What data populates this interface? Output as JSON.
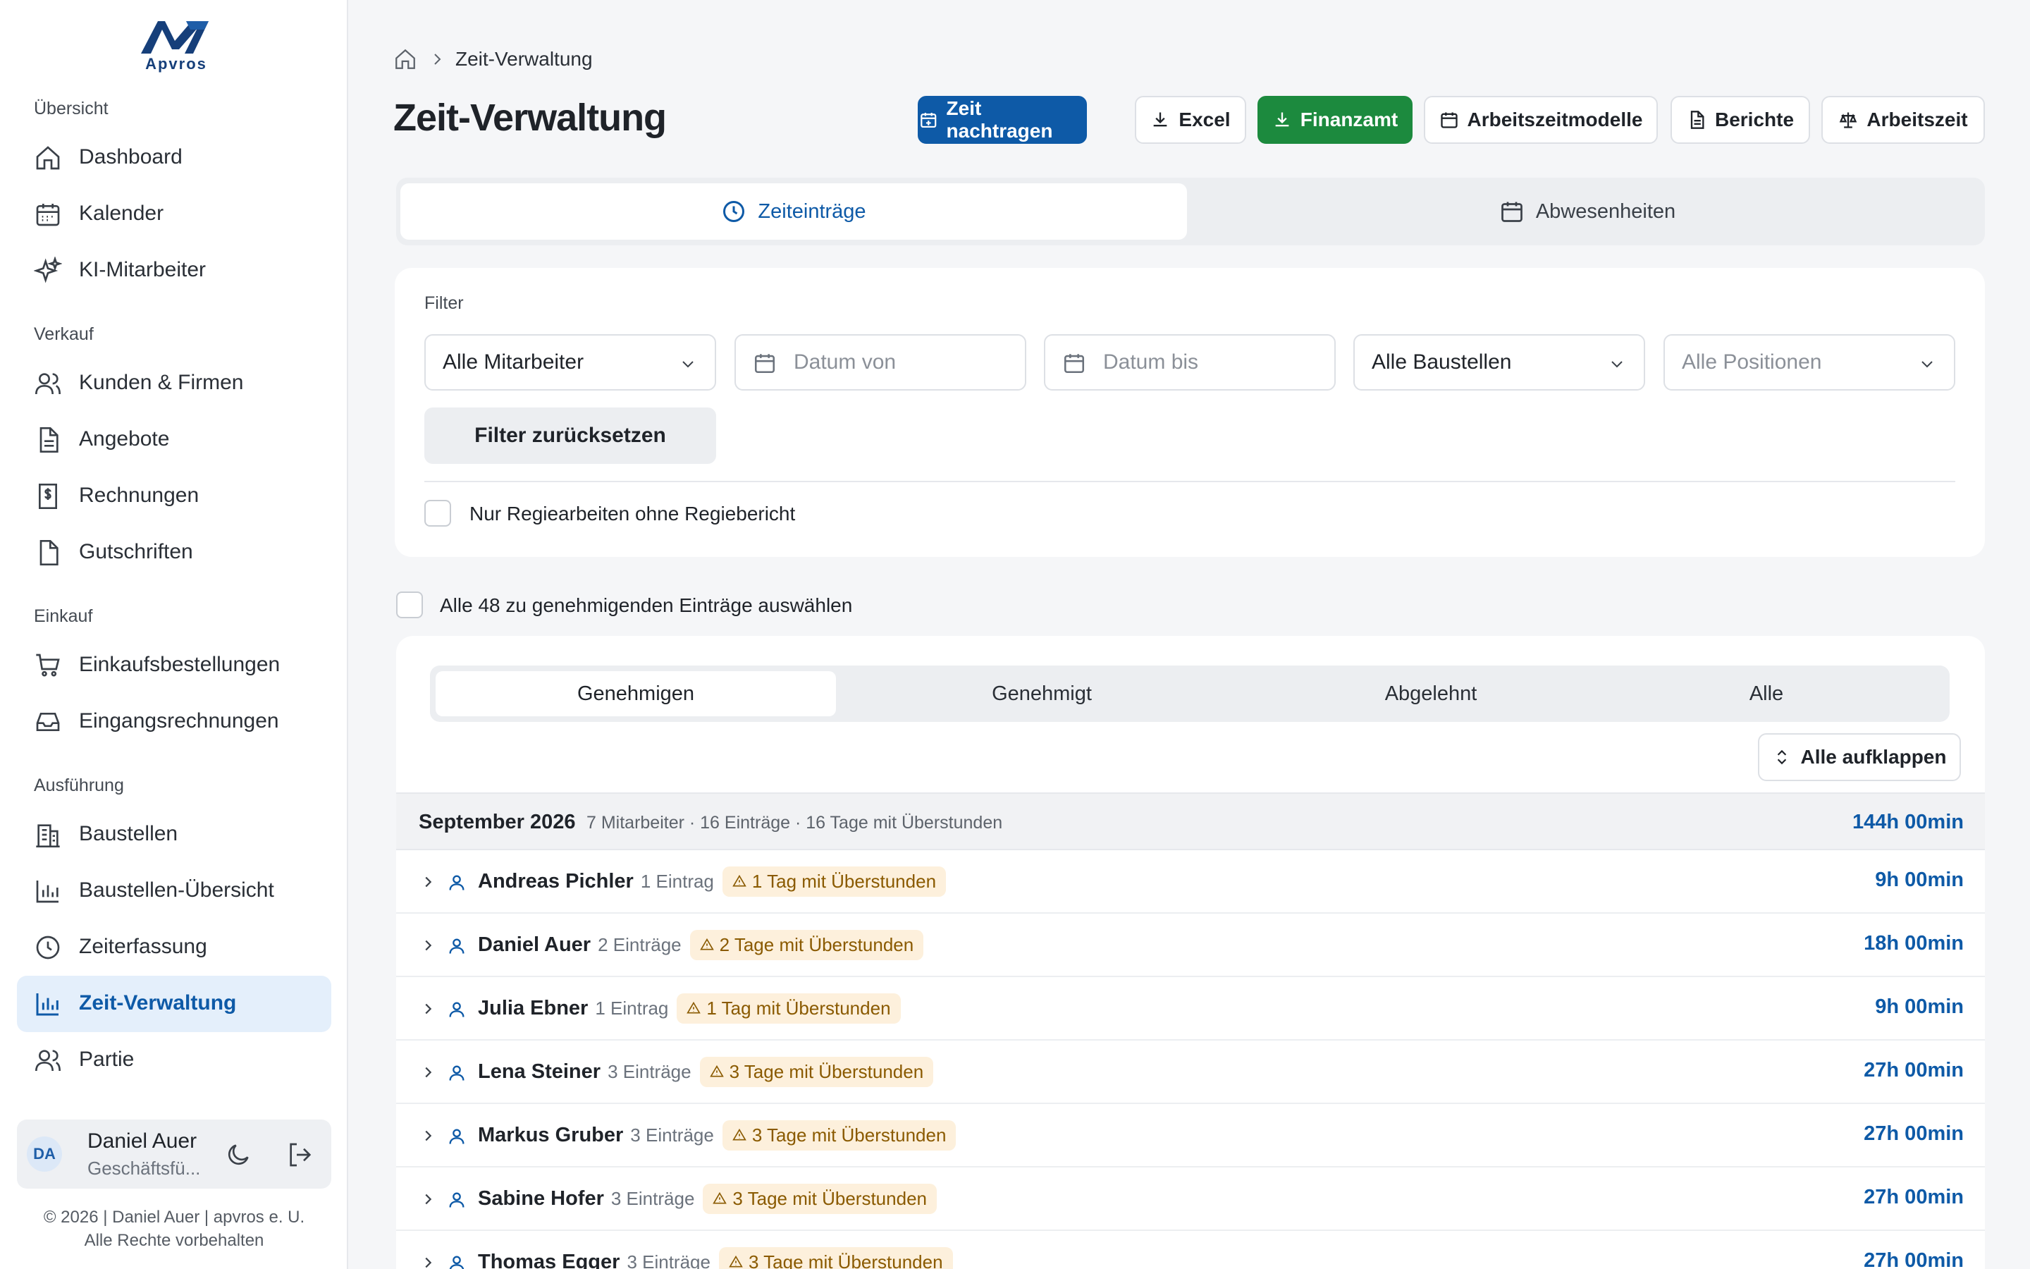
{
  "brand": {
    "logo_text": "Apvros"
  },
  "sidebar": {
    "sections": [
      {
        "title": "Übersicht",
        "items": [
          {
            "label": "Dashboard",
            "icon": "home-icon"
          },
          {
            "label": "Kalender",
            "icon": "calendar-icon"
          },
          {
            "label": "KI-Mitarbeiter",
            "icon": "sparkles-icon"
          }
        ]
      },
      {
        "title": "Verkauf",
        "items": [
          {
            "label": "Kunden & Firmen",
            "icon": "users-icon"
          },
          {
            "label": "Angebote",
            "icon": "document-icon"
          },
          {
            "label": "Rechnungen",
            "icon": "invoice-icon"
          },
          {
            "label": "Gutschriften",
            "icon": "credit-note-icon"
          }
        ]
      },
      {
        "title": "Einkauf",
        "items": [
          {
            "label": "Einkaufsbestellungen",
            "icon": "cart-icon"
          },
          {
            "label": "Eingangsrechnungen",
            "icon": "inbox-icon"
          }
        ]
      },
      {
        "title": "Ausführung",
        "items": [
          {
            "label": "Baustellen",
            "icon": "building-icon"
          },
          {
            "label": "Baustellen-Übersicht",
            "icon": "bar-chart-icon"
          },
          {
            "label": "Zeiterfassung",
            "icon": "clock-icon"
          },
          {
            "label": "Zeit-Verwaltung",
            "icon": "bar-chart-icon",
            "active": true
          },
          {
            "label": "Partie",
            "icon": "users-icon"
          }
        ]
      }
    ]
  },
  "user": {
    "initials": "DA",
    "name": "Daniel Auer",
    "role": "Geschäftsfü..."
  },
  "footer": {
    "line1": "© 2026 | Daniel Auer | apvros e. U.",
    "line2": "Alle Rechte vorbehalten"
  },
  "breadcrumb": {
    "current": "Zeit-Verwaltung"
  },
  "page": {
    "title": "Zeit-Verwaltung"
  },
  "toolbar": {
    "zeit_nachtragen": "Zeit nachtragen",
    "excel": "Excel",
    "finanzamt": "Finanzamt",
    "arbeitszeitmodelle": "Arbeitszeitmodelle",
    "berichte": "Berichte",
    "arbeitszeit": "Arbeitszeit"
  },
  "main_tabs": {
    "zeiteintraege": "Zeiteinträge",
    "abwesenheiten": "Abwesenheiten"
  },
  "filter": {
    "title": "Filter",
    "mitarbeiter": "Alle Mitarbeiter",
    "datum_von_placeholder": "Datum von",
    "datum_bis_placeholder": "Datum bis",
    "baustellen": "Alle Baustellen",
    "positionen_placeholder": "Alle Positionen",
    "reset": "Filter zurücksetzen",
    "regie_checkbox": "Nur Regiearbeiten ohne Regiebericht"
  },
  "select_all_label": "Alle 48 zu genehmigenden Einträge auswählen",
  "status_tabs": {
    "genehmigen": "Genehmigen",
    "genehmigt": "Genehmigt",
    "abgelehnt": "Abgelehnt",
    "alle": "Alle"
  },
  "expand_all": "Alle aufklappen",
  "month": {
    "name": "September 2026",
    "meta": "7 Mitarbeiter · 16 Einträge · 16 Tage mit Überstunden",
    "total": "144h 00min"
  },
  "employees": [
    {
      "name": "Andreas Pichler",
      "count": "1 Eintrag",
      "badge": "1 Tag mit Überstunden",
      "total": "9h 00min"
    },
    {
      "name": "Daniel Auer",
      "count": "2 Einträge",
      "badge": "2 Tage mit Überstunden",
      "total": "18h 00min"
    },
    {
      "name": "Julia Ebner",
      "count": "1 Eintrag",
      "badge": "1 Tag mit Überstunden",
      "total": "9h 00min"
    },
    {
      "name": "Lena Steiner",
      "count": "3 Einträge",
      "badge": "3 Tage mit Überstunden",
      "total": "27h 00min"
    },
    {
      "name": "Markus Gruber",
      "count": "3 Einträge",
      "badge": "3 Tage mit Überstunden",
      "total": "27h 00min"
    },
    {
      "name": "Sabine Hofer",
      "count": "3 Einträge",
      "badge": "3 Tage mit Überstunden",
      "total": "27h 00min"
    },
    {
      "name": "Thomas Egger",
      "count": "3 Einträge",
      "badge": "3 Tage mit Überstunden",
      "total": "27h 00min"
    }
  ],
  "colors": {
    "primary": "#0e5aa7",
    "green": "#1c8a3e",
    "badge_bg": "#fdf0dc",
    "badge_text": "#8a5a00"
  }
}
